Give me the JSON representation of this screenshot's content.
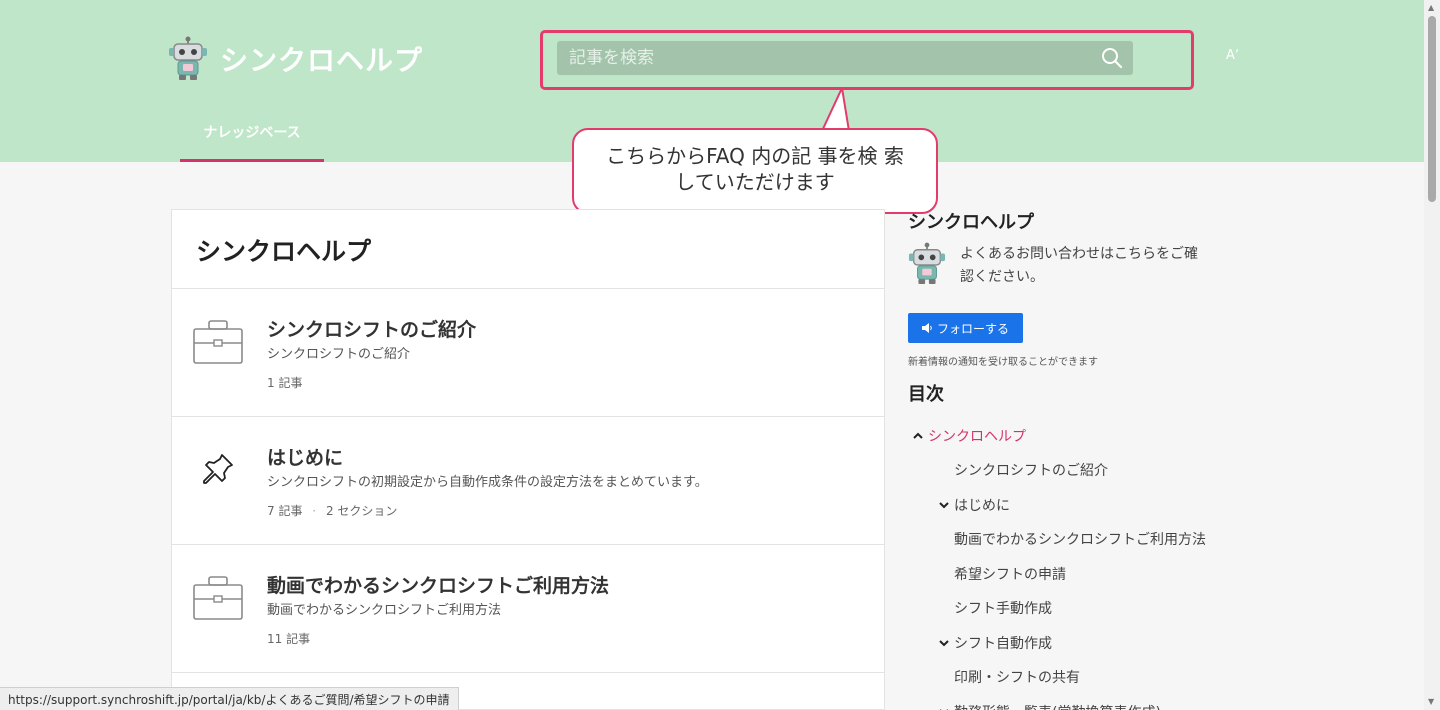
{
  "header": {
    "site_title": "シンクロヘルプ",
    "search_placeholder": "記事を検索",
    "font_button": "Aʼ",
    "nav_tab": "ナレッジベース"
  },
  "callout": {
    "line1": "こちらからFAQ 内の記 事を検 索",
    "line2": "していただけます"
  },
  "main": {
    "title": "シンクロヘルプ",
    "categories": [
      {
        "name": "シンクロシフトのご紹介",
        "desc": "シンクロシフトのご紹介",
        "articles": "1 記事",
        "sections": "",
        "icon": "briefcase-icon"
      },
      {
        "name": "はじめに",
        "desc": "シンクロシフトの初期設定から自動作成条件の設定方法をまとめています。",
        "articles": "7 記事",
        "sections": "2 セクション",
        "icon": "pushpin-icon"
      },
      {
        "name": "動画でわかるシンクロシフトご利用方法",
        "desc": "動画でわかるシンクロシフトご利用方法",
        "articles": "11 記事",
        "sections": "",
        "icon": "briefcase-icon"
      }
    ]
  },
  "sidebar": {
    "title": "シンクロヘルプ",
    "intro": "よくあるお問い合わせはこちらをご確認ください。",
    "follow_label": "フォローする",
    "follow_note": "新着情報の通知を受け取ることができます",
    "toc_title": "目次",
    "toc": [
      {
        "label": "シンクロヘルプ",
        "chevron": "up",
        "active": true
      },
      {
        "label": "シンクロシフトのご紹介",
        "chevron": "",
        "active": false
      },
      {
        "label": "はじめに",
        "chevron": "down",
        "active": false
      },
      {
        "label": "動画でわかるシンクロシフトご利用方法",
        "chevron": "",
        "active": false
      },
      {
        "label": "希望シフトの申請",
        "chevron": "",
        "active": false
      },
      {
        "label": "シフト手動作成",
        "chevron": "",
        "active": false
      },
      {
        "label": "シフト自動作成",
        "chevron": "down",
        "active": false
      },
      {
        "label": "印刷・シフトの共有",
        "chevron": "",
        "active": false
      },
      {
        "label": "勤務形態一覧表(常勤換算表作成)",
        "chevron": "down",
        "active": false
      }
    ]
  },
  "statusbar": {
    "url": "https://support.synchroshift.jp/portal/ja/kb/よくあるご質問/希望シフトの申請"
  },
  "colors": {
    "header_bg": "#c0e6ca",
    "accent": "#d6336c",
    "highlight": "#e33b6b",
    "follow_button": "#1a73e8"
  }
}
